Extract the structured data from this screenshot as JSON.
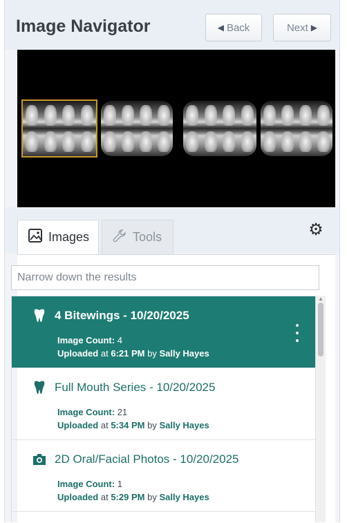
{
  "header": {
    "title": "Image Navigator",
    "back_label": "Back",
    "next_label": "Next"
  },
  "viewer": {
    "thumbnails": [
      {
        "icon": "bitewing-xray",
        "selected": true
      },
      {
        "icon": "bitewing-xray",
        "selected": false
      },
      {
        "icon": "bitewing-xray",
        "selected": false
      },
      {
        "icon": "bitewing-xray",
        "selected": false
      }
    ]
  },
  "tabs": [
    {
      "label": "Images",
      "icon": "image-icon",
      "active": true
    },
    {
      "label": "Tools",
      "icon": "wrench-icon",
      "active": false
    }
  ],
  "search": {
    "placeholder": "Narrow down the results",
    "value": ""
  },
  "list": {
    "items": [
      {
        "name": "4 Bitewings - 10/20/2025",
        "icon": "tooth-icon",
        "active": true,
        "count_label": "Image Count:",
        "count_value": "4",
        "uploaded_prefix": "Uploaded",
        "uploaded_at": "at",
        "uploaded_time": "6:21 PM",
        "uploaded_by": "by",
        "uploader": "Sally Hayes"
      },
      {
        "name": "Full Mouth Series - 10/20/2025",
        "icon": "tooth-icon",
        "active": false,
        "count_label": "Image Count:",
        "count_value": "21",
        "uploaded_prefix": "Uploaded",
        "uploaded_at": "at",
        "uploaded_time": "5:34 PM",
        "uploaded_by": "by",
        "uploader": "Sally Hayes"
      },
      {
        "name": "2D Oral/Facial Photos - 10/20/2025",
        "icon": "camera-icon",
        "active": false,
        "count_label": "Image Count:",
        "count_value": "1",
        "uploaded_prefix": "Uploaded",
        "uploaded_at": "at",
        "uploaded_time": "5:29 PM",
        "uploaded_by": "by",
        "uploader": "Sally Hayes"
      }
    ]
  },
  "colors": {
    "accent": "#1d7c73",
    "selected_thumb_border": "#c79b2e"
  }
}
